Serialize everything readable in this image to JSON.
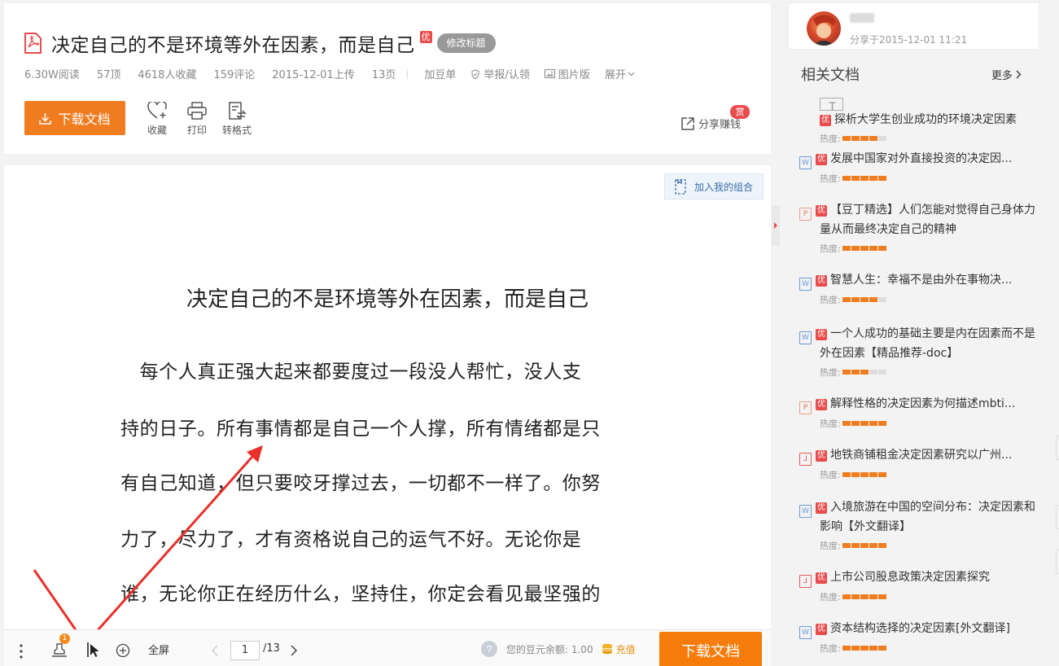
{
  "header": {
    "title": "决定自己的不是环境等外在因素，而是自己",
    "title_badge": "优",
    "edit_title": "修改标题",
    "meta": [
      "6.30W阅读",
      "57顶",
      "4618人收藏",
      "159评论",
      "2015-12-01上传",
      "13页"
    ],
    "links": [
      "加豆单",
      "举报/认领",
      "图片版",
      "展开"
    ],
    "download": "下载文档",
    "tools": [
      "收藏",
      "打印",
      "转格式"
    ],
    "share": "分享赚钱",
    "share_badge": "赏"
  },
  "reader": {
    "add_combo": "加入我的组合",
    "page_title": "决定自己的不是环境等外在因素，而是自己",
    "lines": [
      "　每个人真正强大起来都要度过一段没人帮忙，没人支",
      "持的日子。所有事情都是自己一个人撑，所有情绪都是只",
      "有自己知道，但只要咬牙撑过去，一切都不一样了。你努",
      "力了，尽力了，才有资格说自己的运气不好。无论你是",
      "谁，无论你正在经历什么，坚持住，你定会看见最坚强的"
    ]
  },
  "toolbar": {
    "badge": "1",
    "fullscreen": "全屏",
    "page": "1",
    "total": "/13",
    "balance": "您的豆元余额: 1.00",
    "recharge": "充值",
    "download": "下载文档"
  },
  "uploader": {
    "share_time": "分享于2015-12-01 11:21"
  },
  "related": {
    "heading": "相关文档",
    "more": "更多",
    "heat_label": "热度:",
    "items": [
      {
        "icon": "t",
        "title": "探析大学生创业成功的环境决定因素",
        "heat": 4
      },
      {
        "icon": "w",
        "title": "发展中国家对外直接投资的决定因...",
        "heat": 5
      },
      {
        "icon": "p",
        "title": "【豆丁精选】人们怎能对觉得自己身体力量从而最终决定自己的精神",
        "heat": 5
      },
      {
        "icon": "w",
        "title": "智慧人生：幸福不是由外在事物决...",
        "heat": 4
      },
      {
        "icon": "w",
        "title": "一个人成功的基础主要是内在因素而不是外在因素【精品推荐-doc】",
        "heat": 3
      },
      {
        "icon": "p",
        "title": "解释性格的决定因素为何描述mbti...",
        "heat": 5
      },
      {
        "icon": "pdf",
        "title": "地铁商铺租金决定因素研究以广州...",
        "heat": 5
      },
      {
        "icon": "w",
        "title": "入境旅游在中国的空间分布：决定因素和影响【外文翻译】",
        "heat": 5
      },
      {
        "icon": "pdf",
        "title": "上市公司股息政策决定因素探究",
        "heat": 5
      },
      {
        "icon": "w",
        "title": "资本结构选择的决定因素[外文翻译]",
        "heat": 5
      }
    ]
  }
}
